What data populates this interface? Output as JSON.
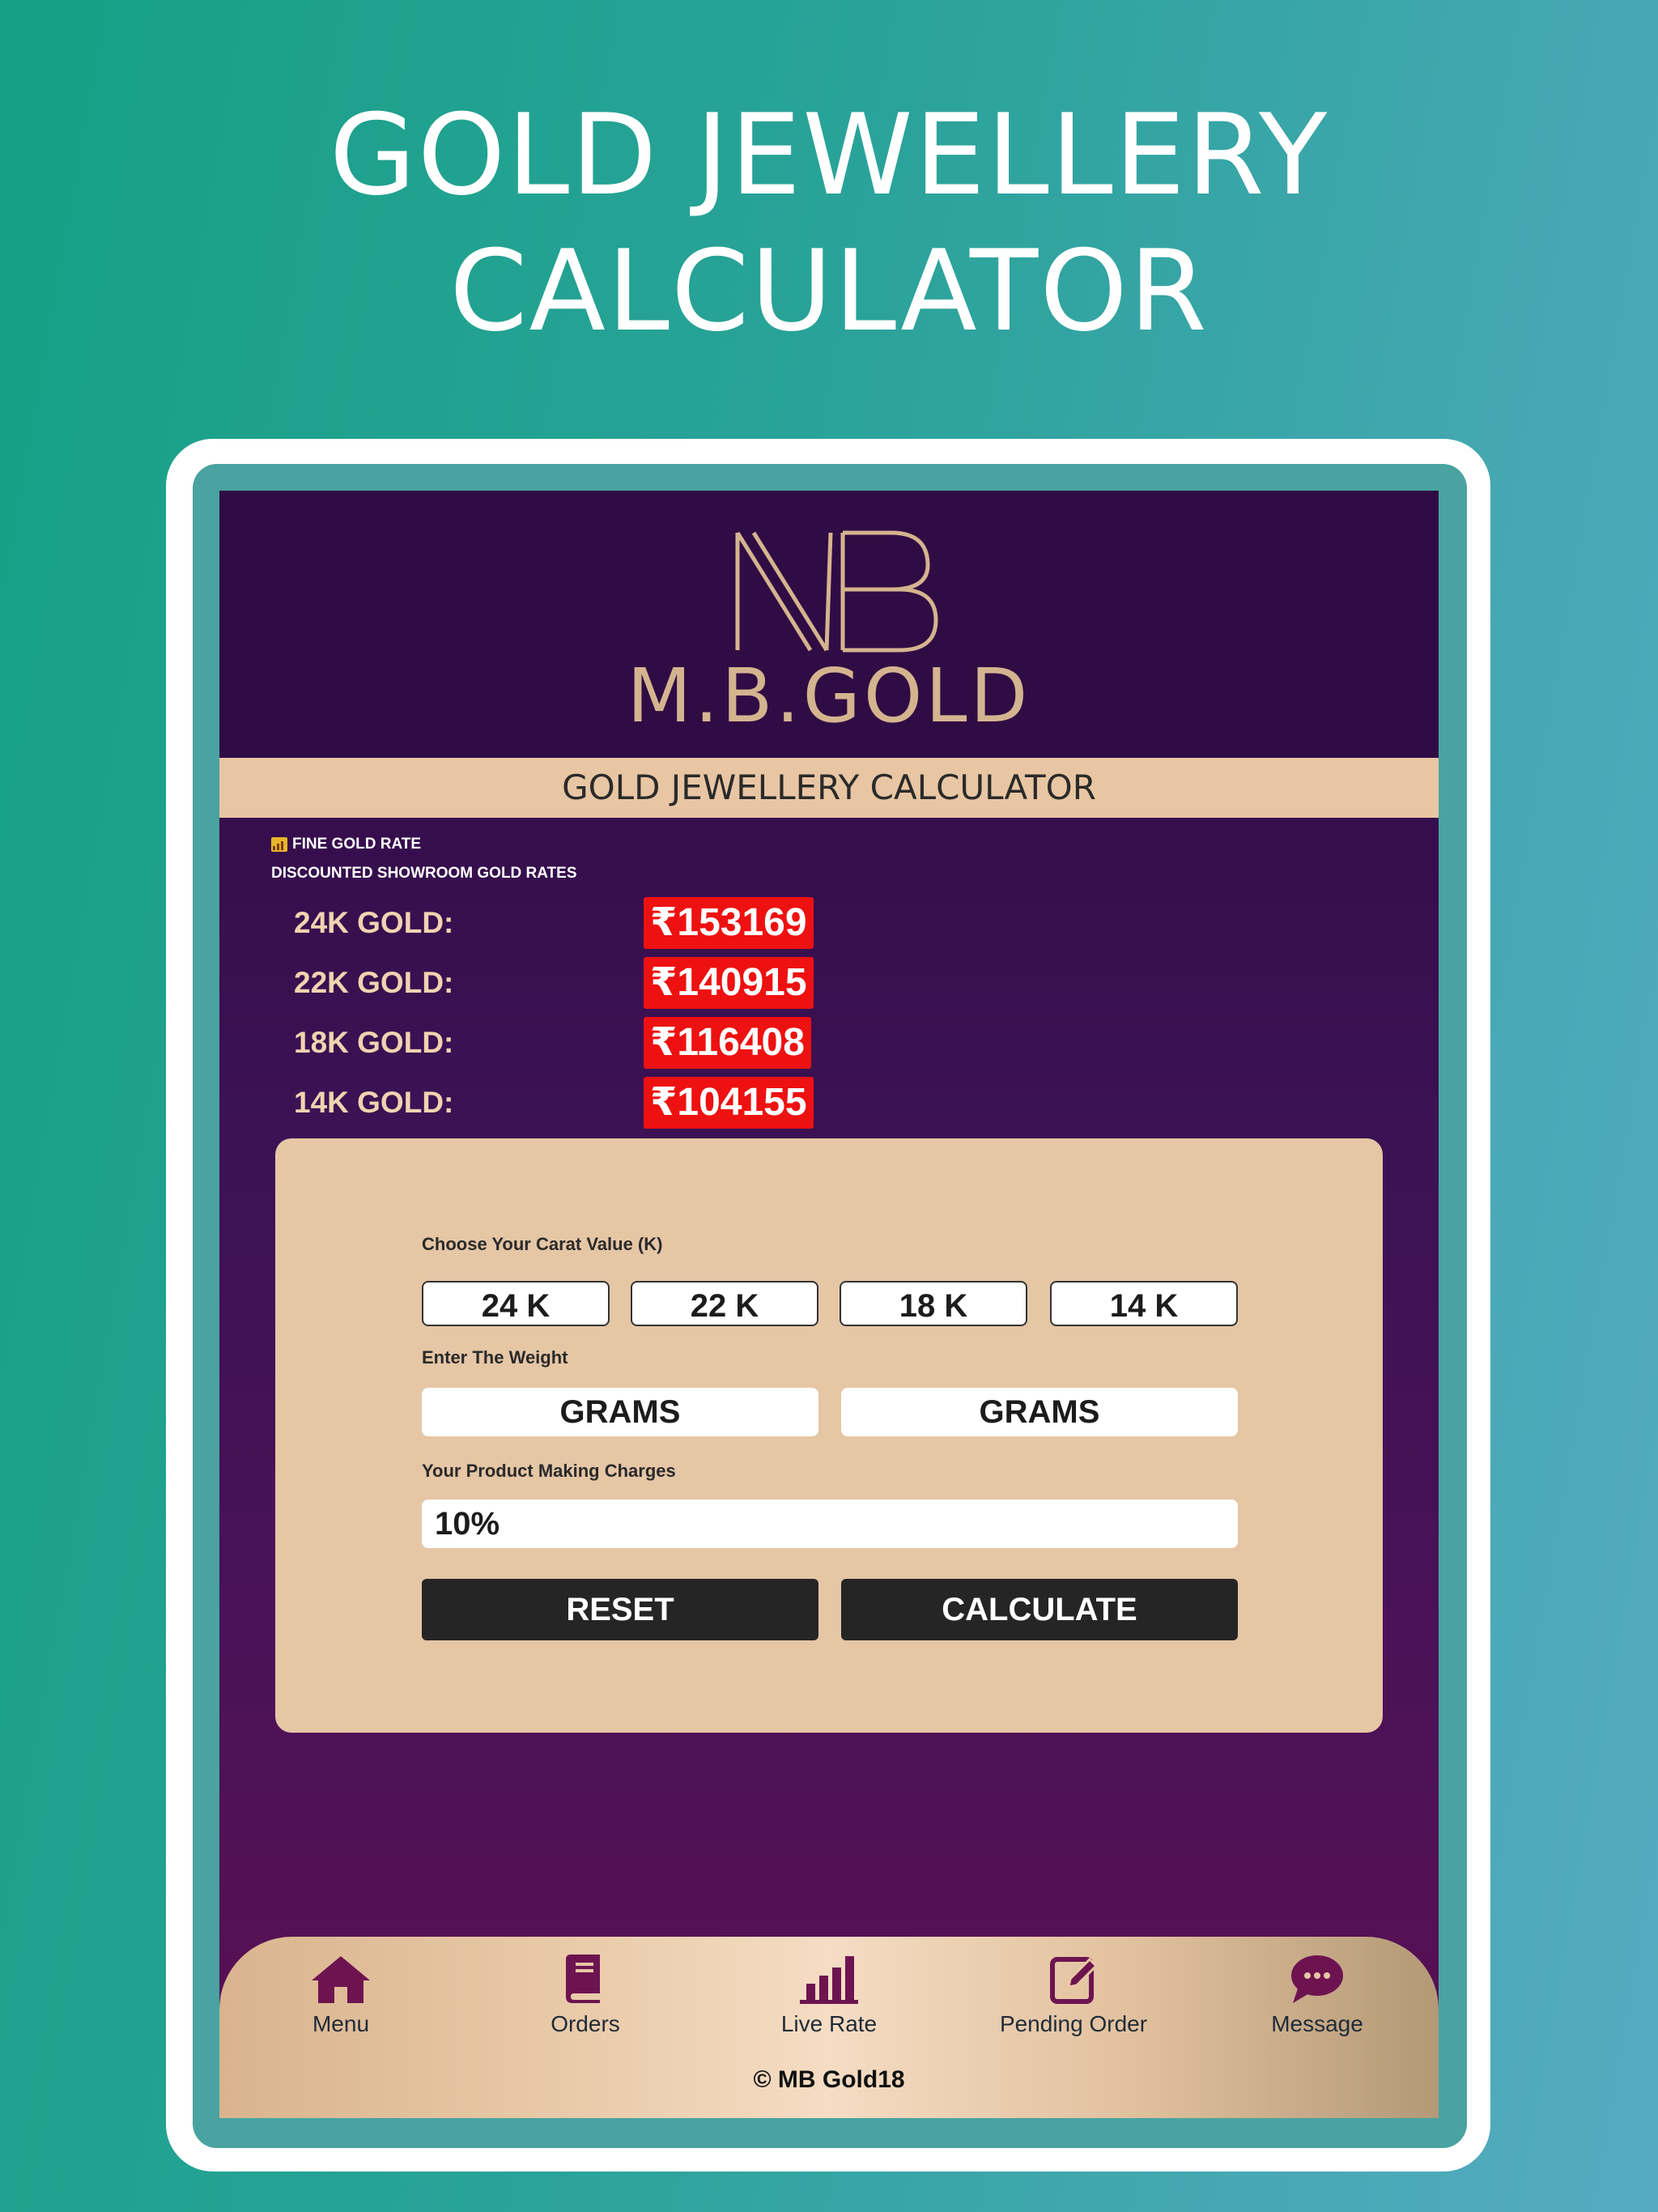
{
  "promo": {
    "line1": "GOLD  JEWELLERY",
    "line2": "CALCULATOR"
  },
  "brand": {
    "monogram": "MB",
    "name": "M.B.GOLD",
    "logo_color": "#d4b48f"
  },
  "page_title": "GOLD JEWELLERY CALCULATOR",
  "rates": {
    "heading": "FINE GOLD RATE",
    "subheading": "DISCOUNTED SHOWROOM GOLD RATES",
    "items": [
      {
        "label": "24K GOLD:",
        "value": "₹153169"
      },
      {
        "label": "22K GOLD:",
        "value": "₹140915"
      },
      {
        "label": "18K GOLD:",
        "value": "₹116408"
      },
      {
        "label": "14K GOLD:",
        "value": "₹104155"
      }
    ]
  },
  "calculator": {
    "carat_label": "Choose Your Carat Value (K)",
    "carat_options": [
      "24 K",
      "22 K",
      "18 K",
      "14 K"
    ],
    "weight_label": "Enter The Weight",
    "weight_fields": [
      "GRAMS",
      "GRAMS"
    ],
    "charges_label": "Your Product Making Charges",
    "charges_value": "10%",
    "reset_label": "RESET",
    "calculate_label": "CALCULATE"
  },
  "nav": {
    "items": [
      {
        "label": "Menu",
        "icon": "home-icon"
      },
      {
        "label": "Orders",
        "icon": "book-icon"
      },
      {
        "label": "Live Rate",
        "icon": "bar-chart-icon"
      },
      {
        "label": "Pending Order",
        "icon": "edit-icon"
      },
      {
        "label": "Message",
        "icon": "chat-icon"
      }
    ],
    "icon_color": "#6d1450"
  },
  "footer": {
    "copyright": "© MB Gold18"
  },
  "colors": {
    "rate_badge": "#ee1111",
    "card": "#e5c6a5",
    "screen_top": "#2f0a45",
    "screen_bottom": "#5a1052"
  }
}
